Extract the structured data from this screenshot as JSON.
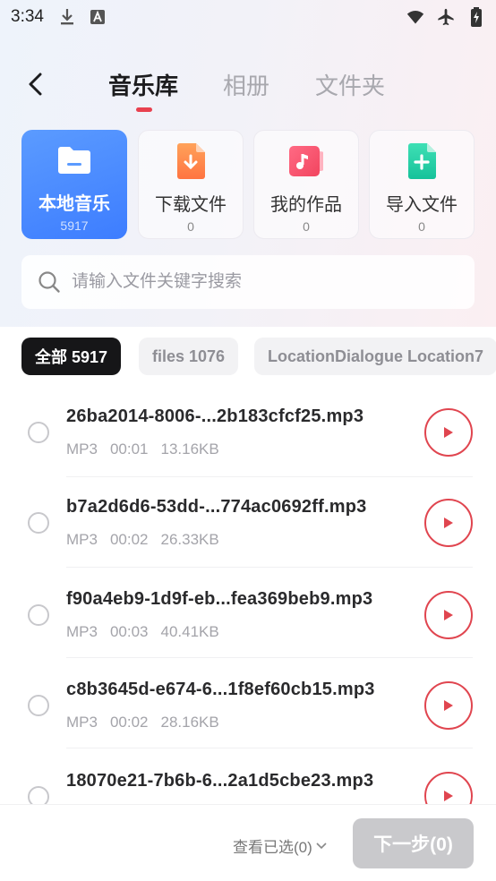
{
  "status_bar": {
    "time": "3:34",
    "left_icons": [
      "download-icon",
      "font-icon"
    ],
    "right_icons": [
      "wifi-icon",
      "airplane-icon",
      "battery-charging-icon"
    ]
  },
  "nav": {
    "tabs": [
      {
        "label": "音乐库",
        "active": true
      },
      {
        "label": "相册",
        "active": false
      },
      {
        "label": "文件夹",
        "active": false
      }
    ],
    "accent": "#e8414f"
  },
  "categories": [
    {
      "label": "本地音乐",
      "count": "5917",
      "icon": "folder-icon",
      "active": true
    },
    {
      "label": "下载文件",
      "count": "0",
      "icon": "download-file-icon",
      "active": false
    },
    {
      "label": "我的作品",
      "count": "0",
      "icon": "music-note-icon",
      "active": false
    },
    {
      "label": "导入文件",
      "count": "0",
      "icon": "add-file-icon",
      "active": false
    }
  ],
  "search": {
    "placeholder": "请输入文件关键字搜索"
  },
  "chips": [
    {
      "label": "全部 5917",
      "active": true
    },
    {
      "label": "files 1076",
      "active": false
    },
    {
      "label": "LocationDialogue Location7",
      "active": false
    }
  ],
  "files": [
    {
      "name": "26ba2014-8006-...2b183cfcf25.mp3",
      "format": "MP3",
      "duration": "00:01",
      "size": "13.16KB"
    },
    {
      "name": "b7a2d6d6-53dd-...774ac0692ff.mp3",
      "format": "MP3",
      "duration": "00:02",
      "size": "26.33KB"
    },
    {
      "name": "f90a4eb9-1d9f-eb...fea369beb9.mp3",
      "format": "MP3",
      "duration": "00:03",
      "size": "40.41KB"
    },
    {
      "name": "c8b3645d-e674-6...1f8ef60cb15.mp3",
      "format": "MP3",
      "duration": "00:02",
      "size": "28.16KB"
    },
    {
      "name": "18070e21-7b6b-6...2a1d5cbe23.mp3",
      "format": "",
      "duration": "",
      "size": ""
    }
  ],
  "bottom": {
    "view_selected": "查看已选(0)",
    "next_button": "下一步(0)"
  },
  "colors": {
    "accent_red": "#e0454f",
    "active_card_blue": "#4a89ff",
    "disabled_button": "#c9c9cc"
  }
}
